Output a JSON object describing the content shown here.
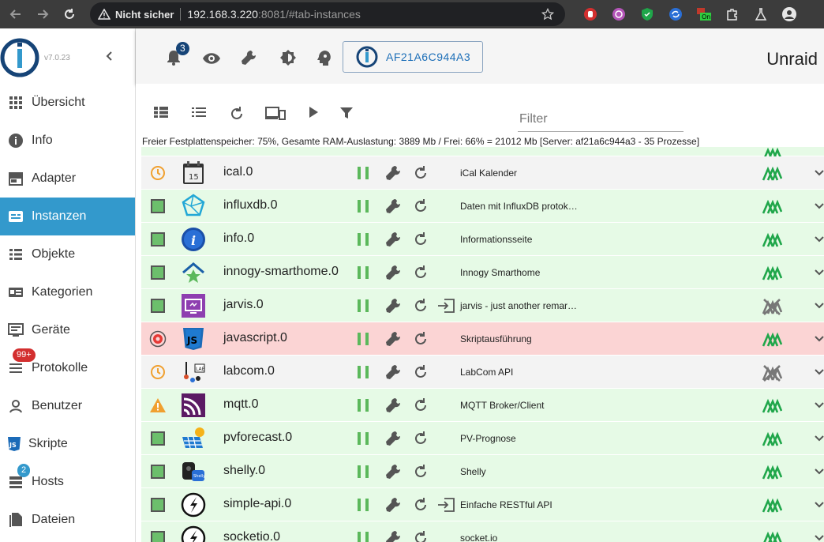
{
  "browser": {
    "insecure_label": "Nicht sicher",
    "url_host": "192.168.3.220",
    "url_path": ":8081/#tab-instances"
  },
  "sidebar": {
    "version": "v7.0.23",
    "items": [
      {
        "label": "Übersicht",
        "icon": "grid-icon"
      },
      {
        "label": "Info",
        "icon": "info-icon"
      },
      {
        "label": "Adapter",
        "icon": "store-icon"
      },
      {
        "label": "Instanzen",
        "icon": "instances-icon",
        "active": true
      },
      {
        "label": "Objekte",
        "icon": "list-icon"
      },
      {
        "label": "Kategorien",
        "icon": "category-icon"
      },
      {
        "label": "Geräte",
        "icon": "devices-icon"
      },
      {
        "label": "Protokolle",
        "icon": "log-icon",
        "badge": "99+"
      },
      {
        "label": "Benutzer",
        "icon": "user-icon"
      },
      {
        "label": "Skripte",
        "icon": "js-icon"
      },
      {
        "label": "Hosts",
        "icon": "hosts-icon",
        "badge": "2"
      },
      {
        "label": "Dateien",
        "icon": "files-icon"
      }
    ]
  },
  "appbar": {
    "notifications_count": "3",
    "host_name": "AF21A6C944A3",
    "brand": "Unraid"
  },
  "toolbar": {
    "filter_label": "Filter",
    "status": "Freier Festplattenspeicher: 75%, Gesamte RAM-Auslastung: 3889 Mb / Frei: 66% = 21012 Mb [Server: af21a6c944a3 - 35 Prozesse]"
  },
  "instances": [
    {
      "name": "ical.0",
      "desc": "iCal Kalender",
      "status": "schedule",
      "row": "grey",
      "connected": true,
      "extra_link": false
    },
    {
      "name": "influxdb.0",
      "desc": "Daten mit InfluxDB protok…",
      "status": "running",
      "row": "green",
      "connected": true,
      "extra_link": false
    },
    {
      "name": "info.0",
      "desc": "Informationsseite",
      "status": "running",
      "row": "green",
      "connected": true,
      "extra_link": false
    },
    {
      "name": "innogy-smarthome.0",
      "desc": "Innogy Smarthome",
      "status": "running",
      "row": "green",
      "connected": true,
      "extra_link": false
    },
    {
      "name": "jarvis.0",
      "desc": "jarvis - just another remar…",
      "status": "running",
      "row": "green",
      "connected": false,
      "extra_link": true
    },
    {
      "name": "javascript.0",
      "desc": "Skriptausführung",
      "status": "error",
      "row": "red",
      "connected": true,
      "extra_link": false
    },
    {
      "name": "labcom.0",
      "desc": "LabCom API",
      "status": "schedule",
      "row": "grey",
      "connected": false,
      "extra_link": false
    },
    {
      "name": "mqtt.0",
      "desc": "MQTT Broker/Client",
      "status": "warning",
      "row": "green",
      "connected": true,
      "extra_link": false
    },
    {
      "name": "pvforecast.0",
      "desc": "PV-Prognose",
      "status": "running",
      "row": "green",
      "connected": true,
      "extra_link": false
    },
    {
      "name": "shelly.0",
      "desc": "Shelly",
      "status": "running",
      "row": "green",
      "connected": true,
      "extra_link": false
    },
    {
      "name": "simple-api.0",
      "desc": "Einfache RESTful API",
      "status": "running",
      "row": "green",
      "connected": true,
      "extra_link": true
    },
    {
      "name": "socketio.0",
      "desc": "socket.io",
      "status": "running",
      "row": "green",
      "connected": true,
      "extra_link": false
    }
  ]
}
